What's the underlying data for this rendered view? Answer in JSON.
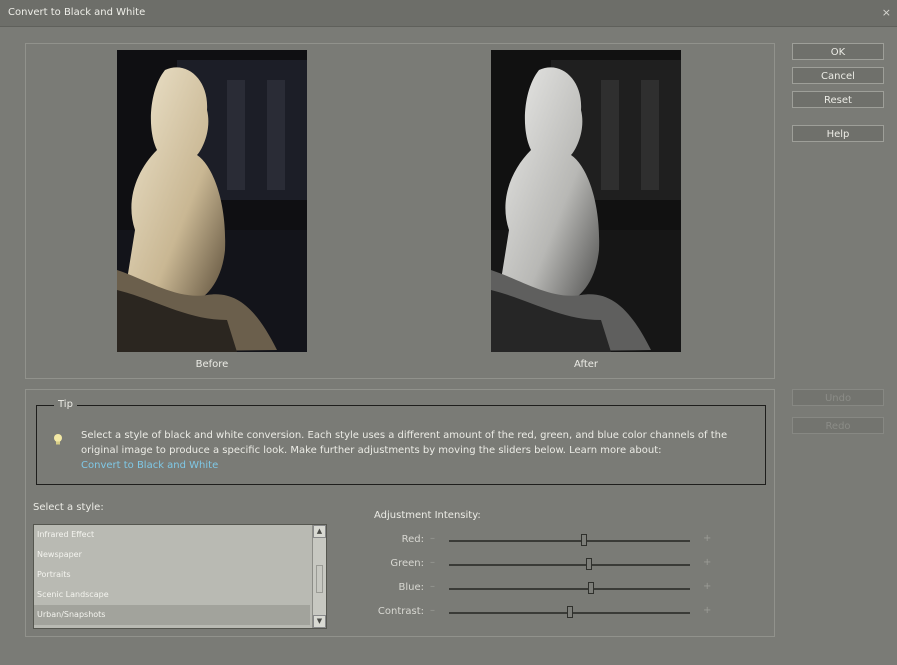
{
  "window": {
    "title": "Convert to Black and White",
    "close_glyph": "×"
  },
  "preview": {
    "before_label": "Before",
    "after_label": "After"
  },
  "buttons": {
    "ok": "OK",
    "cancel": "Cancel",
    "reset": "Reset",
    "help": "Help",
    "undo": "Undo",
    "redo": "Redo"
  },
  "tip": {
    "legend": "Tip",
    "icon": "lightbulb-icon",
    "text": "Select a style of black and white conversion. Each style uses a different amount of the red, green, and blue color channels of the original image to produce a specific look. Make further adjustments by moving the sliders below. Learn more about:",
    "link": "Convert to Black and White"
  },
  "style_select": {
    "label": "Select a style:",
    "items": [
      "Infrared Effect",
      "Newspaper",
      "Portraits",
      "Scenic Landscape",
      "Urban/Snapshots"
    ],
    "selected": "Urban/Snapshots"
  },
  "adjustment": {
    "label": "Adjustment Intensity:",
    "minus": "–",
    "plus": "+",
    "sliders": [
      {
        "name": "Red:",
        "value": 0.56
      },
      {
        "name": "Green:",
        "value": 0.58
      },
      {
        "name": "Blue:",
        "value": 0.59
      },
      {
        "name": "Contrast:",
        "value": 0.5
      }
    ]
  }
}
